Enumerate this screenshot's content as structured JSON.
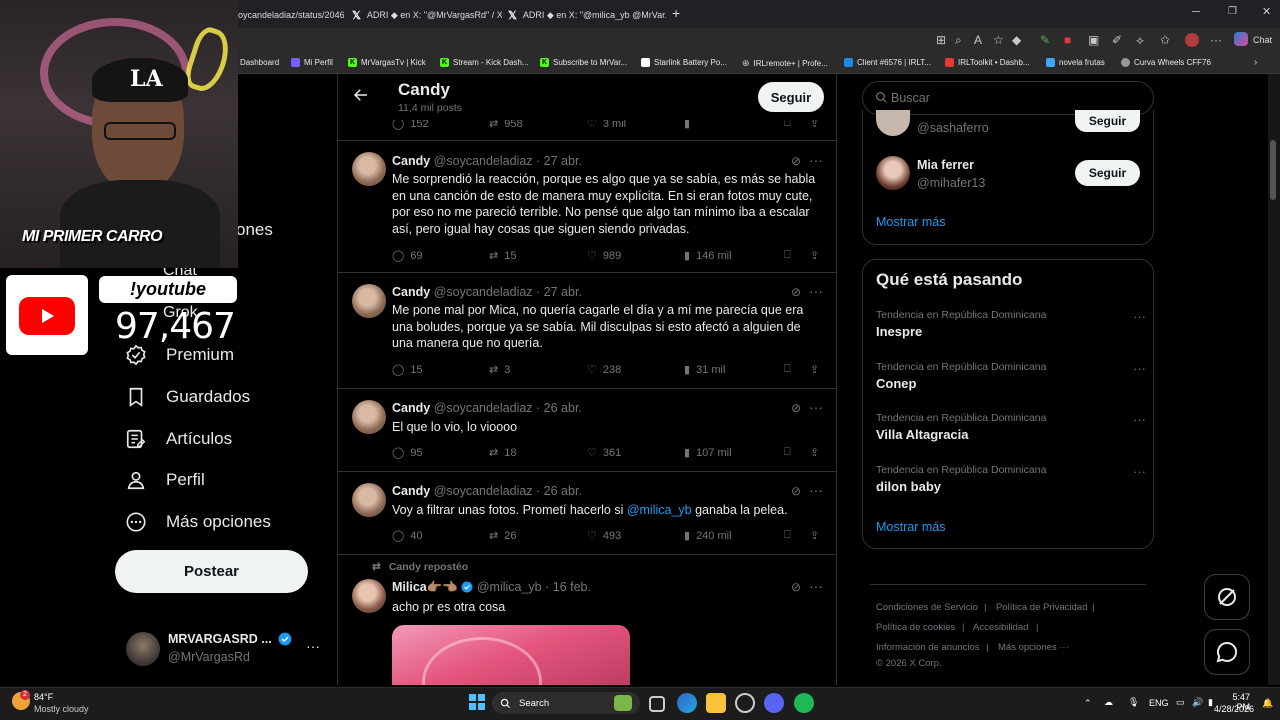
{
  "browser": {
    "tabs": [
      {
        "label": "oycandeladiaz/status/2046"
      },
      {
        "label": "ADRI ◆ en X: \"@MrVargasRd\" / X"
      },
      {
        "label": "ADRI ◆ en X: \"@milica_yb @MrVar..."
      }
    ],
    "chat_label": "Chat",
    "bookmarks": [
      {
        "label": "Dashboard"
      },
      {
        "label": "Mi Perfil"
      },
      {
        "label": "MrVargasTv | Kick"
      },
      {
        "label": "Stream - Kick Dash..."
      },
      {
        "label": "Subscribe to MrVar..."
      },
      {
        "label": "Starlink Battery Po..."
      },
      {
        "label": "IRLremote+ | Profe..."
      },
      {
        "label": "Client #6576 | IRLT..."
      },
      {
        "label": "IRLToolkit • Dashb..."
      },
      {
        "label": "novela frutas"
      },
      {
        "label": "Curva Wheels CFF76"
      }
    ]
  },
  "overlay": {
    "banner": "MI PRIMER CARRO",
    "youtube_label": "!youtube",
    "youtube_count": "97,467"
  },
  "nav": {
    "partial_items": [
      "ones",
      "Chat",
      "Grok"
    ],
    "items": [
      {
        "label": "Premium",
        "icon": "verified-icon"
      },
      {
        "label": "Guardados",
        "icon": "bookmark-icon"
      },
      {
        "label": "Artículos",
        "icon": "articles-icon"
      },
      {
        "label": "Perfil",
        "icon": "person-icon"
      },
      {
        "label": "Más opciones",
        "icon": "more-circle-icon"
      }
    ],
    "post_button": "Postear",
    "account": {
      "name": "MRVARGASRD ...",
      "handle": "@MrVargasRd"
    }
  },
  "timeline": {
    "header": {
      "title": "Candy",
      "subtitle": "11,4 mil posts",
      "follow": "Seguir"
    },
    "top_actions": {
      "replies": "152",
      "reposts": "958",
      "likes": "3 mil"
    },
    "tweets": [
      {
        "name": "Candy",
        "handle": "@soycandeladiaz",
        "date": "· 27 abr.",
        "text": "Me sorprendió la reacción, porque es algo que ya se sabía, es más se habla en una canción de esto de manera muy explícita. En si eran fotos muy cute, por eso no me pareció terrible. No pensé que algo tan mínimo iba a escalar así, pero igual hay cosas que siguen siendo privadas.",
        "replies": "69",
        "reposts": "15",
        "likes": "989",
        "views": "146 mil"
      },
      {
        "name": "Candy",
        "handle": "@soycandeladiaz",
        "date": "· 27 abr.",
        "text": "Me pone mal por Mica, no quería cagarle el día y a mí me parecía que era una boludes, porque ya se sabía. Mil disculpas si esto afectó a alguien de una manera que no quería.",
        "replies": "15",
        "reposts": "3",
        "likes": "238",
        "views": "31 mil"
      },
      {
        "name": "Candy",
        "handle": "@soycandeladiaz",
        "date": "· 26 abr.",
        "text": "El que lo vio, lo vioooo",
        "replies": "95",
        "reposts": "18",
        "likes": "361",
        "views": "107 mil"
      },
      {
        "name": "Candy",
        "handle": "@soycandeladiaz",
        "date": "· 26 abr.",
        "text_before": "Voy a filtrar unas fotos. Prometí hacerlo si ",
        "mention": "@milica_yb",
        "text_after": " ganaba la pelea.",
        "replies": "40",
        "reposts": "26",
        "likes": "493",
        "views": "240 mil"
      }
    ],
    "repost": {
      "label": "Candy repostéo",
      "name": "Milica👉🏽👈🏽",
      "handle": "@milica_yb",
      "date": "· 16 feb.",
      "text": "acho pr es otra cosa"
    }
  },
  "right": {
    "search_placeholder": "Buscar",
    "follow_suggestions": [
      {
        "name": "",
        "handle": "@sashaferro",
        "button": "Seguir"
      },
      {
        "name": "Mia ferrer",
        "handle": "@mihafer13",
        "button": "Seguir"
      }
    ],
    "show_more": "Mostrar más",
    "trends_title": "Qué está pasando",
    "trends": [
      {
        "context": "Tendencia en República Dominicana",
        "title": "Inespre"
      },
      {
        "context": "Tendencia en República Dominicana",
        "title": "Conep"
      },
      {
        "context": "Tendencia en República Dominicana",
        "title": "Villa Altagracia"
      },
      {
        "context": "Tendencia en República Dominicana",
        "title": "dilon baby"
      }
    ],
    "trends_more": "Mostrar más",
    "footer": {
      "terms": "Condiciones de Servicio",
      "privacy": "Política de Privacidad",
      "cookies": "Política de cookies",
      "accessibility": "Accesibilidad",
      "ads": "Información de anuncios",
      "more": "Más opciones ···",
      "copyright": "© 2026 X Corp."
    }
  },
  "taskbar": {
    "weather_temp": "84°F",
    "weather_desc": "Mostly cloudy",
    "weather_badge": "2",
    "search": "Search",
    "lang": "ENG",
    "time": "5:47 PM",
    "date": "4/28/2026"
  },
  "colors": {
    "accent": "#1d9bf0",
    "muted": "#71767b",
    "border": "#2f3336"
  }
}
